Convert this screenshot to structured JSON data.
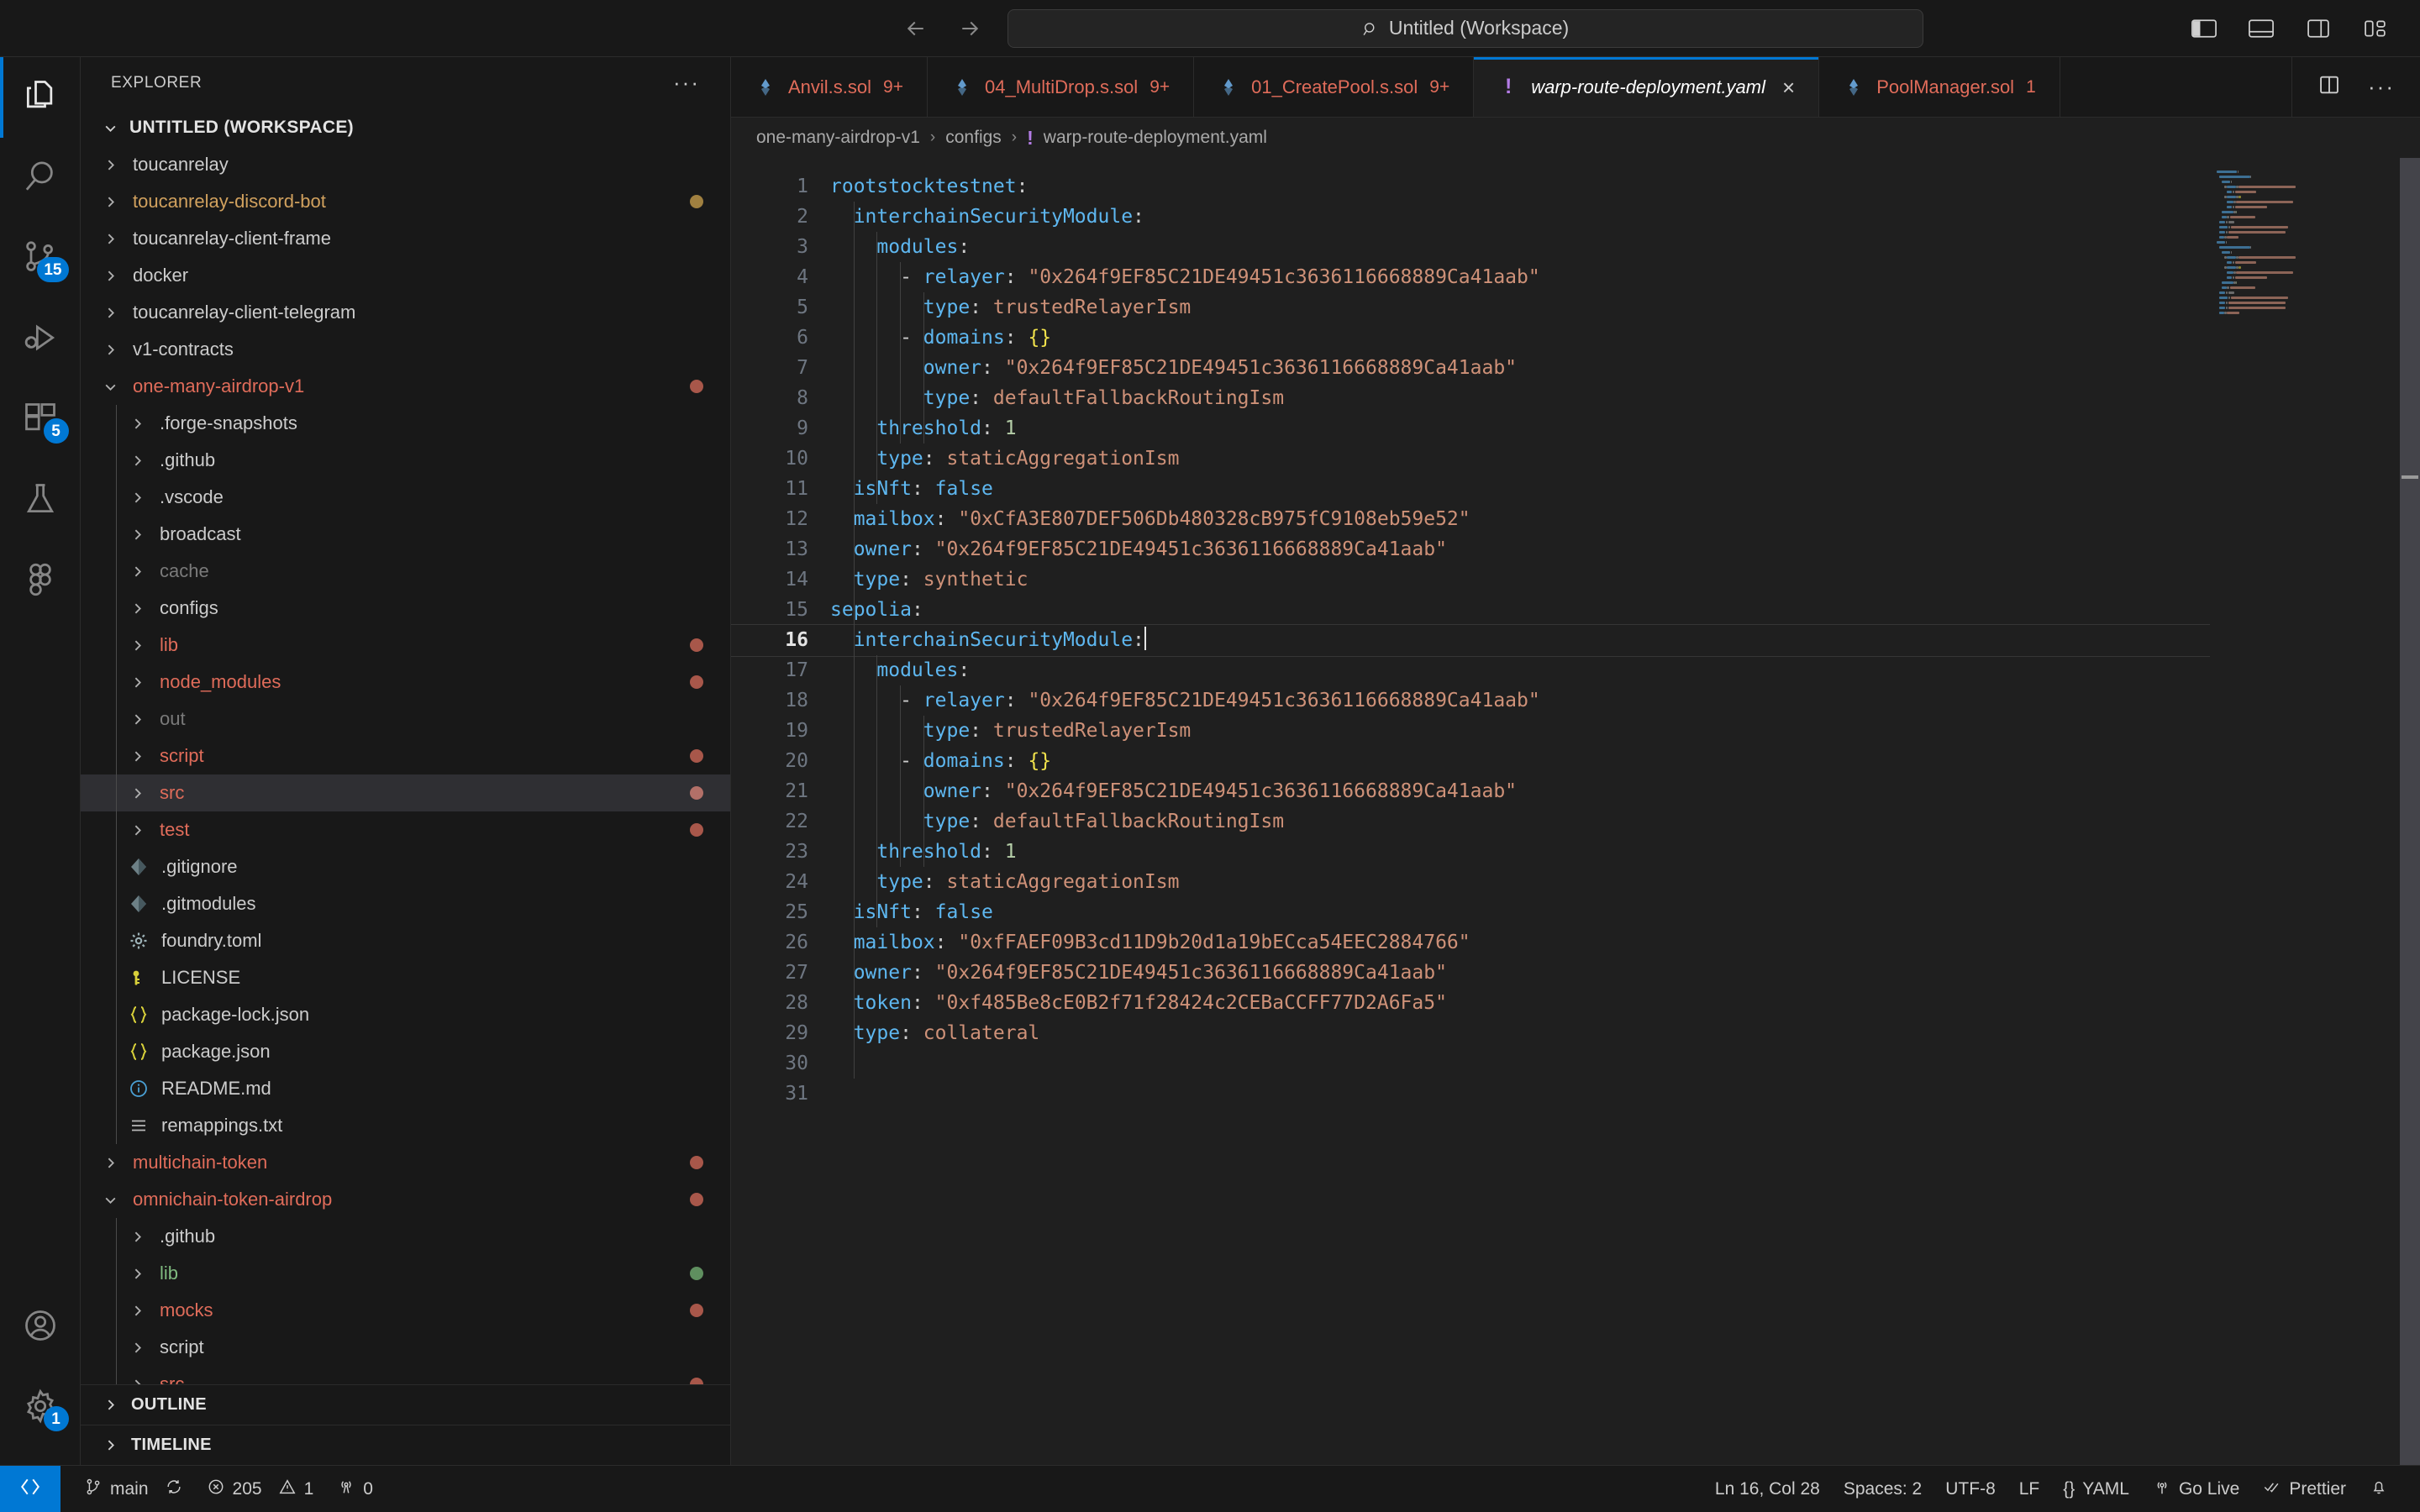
{
  "titlebar": {
    "back_label": "←",
    "forward_label": "→",
    "command_center_text": "Untitled (Workspace)",
    "layout_icons": [
      "toggle-primary-sidebar",
      "toggle-panel",
      "toggle-secondary-sidebar",
      "customize-layout"
    ]
  },
  "activitybar": {
    "items": [
      {
        "name": "explorer",
        "icon": "files-icon",
        "badge": ""
      },
      {
        "name": "search",
        "icon": "search-icon",
        "badge": ""
      },
      {
        "name": "source-control",
        "icon": "source-control-icon",
        "badge": "15"
      },
      {
        "name": "run-and-debug",
        "icon": "run-debug-icon",
        "badge": ""
      },
      {
        "name": "extensions",
        "icon": "extensions-icon",
        "badge": "5"
      },
      {
        "name": "testing",
        "icon": "beaker-icon",
        "badge": ""
      },
      {
        "name": "figma",
        "icon": "figma-icon",
        "badge": ""
      }
    ],
    "bottom": [
      {
        "name": "accounts",
        "icon": "account-icon",
        "badge": ""
      },
      {
        "name": "manage",
        "icon": "gear-icon",
        "badge": "1"
      }
    ]
  },
  "sidebar": {
    "header_title": "EXPLORER",
    "more_actions": "···",
    "root_label": "UNTITLED (WORKSPACE)",
    "tree": [
      {
        "label": "toucanrelay",
        "depth": 1,
        "type": "folder",
        "open": false,
        "color": "#cccccc",
        "dot": ""
      },
      {
        "label": "toucanrelay-discord-bot",
        "depth": 1,
        "type": "folder",
        "open": false,
        "color": "#d1a15e",
        "dot": "#a08040"
      },
      {
        "label": "toucanrelay-client-frame",
        "depth": 1,
        "type": "folder",
        "open": false,
        "color": "#cccccc",
        "dot": ""
      },
      {
        "label": "docker",
        "depth": 1,
        "type": "folder",
        "open": false,
        "color": "#cccccc",
        "dot": ""
      },
      {
        "label": "toucanrelay-client-telegram",
        "depth": 1,
        "type": "folder",
        "open": false,
        "color": "#cccccc",
        "dot": ""
      },
      {
        "label": "v1-contracts",
        "depth": 1,
        "type": "folder",
        "open": false,
        "color": "#cccccc",
        "dot": ""
      },
      {
        "label": "one-many-airdrop-v1",
        "depth": 1,
        "type": "folder",
        "open": true,
        "color": "#e06c5a",
        "dot": "#a8574a"
      },
      {
        "label": ".forge-snapshots",
        "depth": 2,
        "type": "folder",
        "open": false,
        "color": "#cccccc",
        "dot": ""
      },
      {
        "label": ".github",
        "depth": 2,
        "type": "folder",
        "open": false,
        "color": "#cccccc",
        "dot": ""
      },
      {
        "label": ".vscode",
        "depth": 2,
        "type": "folder",
        "open": false,
        "color": "#cccccc",
        "dot": ""
      },
      {
        "label": "broadcast",
        "depth": 2,
        "type": "folder",
        "open": false,
        "color": "#cccccc",
        "dot": ""
      },
      {
        "label": "cache",
        "depth": 2,
        "type": "folder",
        "open": false,
        "color": "#7a7a7a",
        "dot": ""
      },
      {
        "label": "configs",
        "depth": 2,
        "type": "folder",
        "open": false,
        "color": "#cccccc",
        "dot": ""
      },
      {
        "label": "lib",
        "depth": 2,
        "type": "folder",
        "open": false,
        "color": "#e06c5a",
        "dot": "#a8574a"
      },
      {
        "label": "node_modules",
        "depth": 2,
        "type": "folder",
        "open": false,
        "color": "#e06c5a",
        "dot": "#a8574a"
      },
      {
        "label": "out",
        "depth": 2,
        "type": "folder",
        "open": false,
        "color": "#7a7a7a",
        "dot": ""
      },
      {
        "label": "script",
        "depth": 2,
        "type": "folder",
        "open": false,
        "color": "#e06c5a",
        "dot": "#a8574a"
      },
      {
        "label": "src",
        "depth": 2,
        "type": "folder",
        "open": false,
        "color": "#e06c5a",
        "dot": "#b37068",
        "selected": true
      },
      {
        "label": "test",
        "depth": 2,
        "type": "folder",
        "open": false,
        "color": "#e06c5a",
        "dot": "#a8574a"
      },
      {
        "label": ".gitignore",
        "depth": 2,
        "type": "git",
        "open": false,
        "color": "#cccccc",
        "dot": ""
      },
      {
        "label": ".gitmodules",
        "depth": 2,
        "type": "git",
        "open": false,
        "color": "#cccccc",
        "dot": ""
      },
      {
        "label": "foundry.toml",
        "depth": 2,
        "type": "toml",
        "open": false,
        "color": "#cccccc",
        "dot": ""
      },
      {
        "label": "LICENSE",
        "depth": 2,
        "type": "license",
        "open": false,
        "color": "#cccccc",
        "dot": ""
      },
      {
        "label": "package-lock.json",
        "depth": 2,
        "type": "json",
        "open": false,
        "color": "#cccccc",
        "dot": ""
      },
      {
        "label": "package.json",
        "depth": 2,
        "type": "json",
        "open": false,
        "color": "#cccccc",
        "dot": ""
      },
      {
        "label": "README.md",
        "depth": 2,
        "type": "md",
        "open": false,
        "color": "#cccccc",
        "dot": ""
      },
      {
        "label": "remappings.txt",
        "depth": 2,
        "type": "txt",
        "open": false,
        "color": "#cccccc",
        "dot": ""
      },
      {
        "label": "multichain-token",
        "depth": 1,
        "type": "folder",
        "open": false,
        "color": "#e06c5a",
        "dot": "#a8574a"
      },
      {
        "label": "omnichain-token-airdrop",
        "depth": 1,
        "type": "folder",
        "open": true,
        "color": "#e06c5a",
        "dot": "#a8574a"
      },
      {
        "label": ".github",
        "depth": 2,
        "type": "folder",
        "open": false,
        "color": "#cccccc",
        "dot": ""
      },
      {
        "label": "lib",
        "depth": 2,
        "type": "folder",
        "open": false,
        "color": "#7fba7f",
        "dot": "#5f8f5f"
      },
      {
        "label": "mocks",
        "depth": 2,
        "type": "folder",
        "open": false,
        "color": "#e06c5a",
        "dot": "#a8574a"
      },
      {
        "label": "script",
        "depth": 2,
        "type": "folder",
        "open": false,
        "color": "#cccccc",
        "dot": ""
      },
      {
        "label": "src",
        "depth": 2,
        "type": "folder",
        "open": false,
        "color": "#e06c5a",
        "dot": "#a8574a"
      }
    ],
    "sections": [
      {
        "label": "OUTLINE"
      },
      {
        "label": "TIMELINE"
      }
    ]
  },
  "tabs": [
    {
      "name": "Anvil.s.sol",
      "count": "9+",
      "icon": "solidity-icon",
      "active": false,
      "dirty": false
    },
    {
      "name": "04_MultiDrop.s.sol",
      "count": "9+",
      "icon": "solidity-icon",
      "active": false,
      "dirty": false
    },
    {
      "name": "01_CreatePool.s.sol",
      "count": "9+",
      "icon": "solidity-icon",
      "active": false,
      "dirty": false
    },
    {
      "name": "warp-route-deployment.yaml",
      "count": "",
      "icon": "yaml-icon",
      "active": true,
      "dirty": false,
      "close_label": "×"
    },
    {
      "name": "PoolManager.sol",
      "count": "1",
      "icon": "solidity-icon",
      "active": false,
      "dirty": false
    }
  ],
  "tab_actions": [
    "split-editor-icon",
    "more-actions-icon"
  ],
  "breadcrumbs": {
    "items": [
      "one-many-airdrop-v1",
      "configs",
      "warp-route-deployment.yaml"
    ],
    "separator": "›",
    "file_icon": "!"
  },
  "editor": {
    "language": "yaml",
    "cursor_line": 16,
    "lines": [
      {
        "n": 1,
        "indent": 0,
        "tokens": [
          {
            "t": "rootstocktestnet",
            "c": "k"
          },
          {
            "t": ":",
            "c": "p"
          }
        ]
      },
      {
        "n": 2,
        "indent": 2,
        "tokens": [
          {
            "t": "interchainSecurityModule",
            "c": "k"
          },
          {
            "t": ":",
            "c": "p"
          }
        ]
      },
      {
        "n": 3,
        "indent": 4,
        "tokens": [
          {
            "t": "modules",
            "c": "k"
          },
          {
            "t": ":",
            "c": "p"
          }
        ]
      },
      {
        "n": 4,
        "indent": 6,
        "tokens": [
          {
            "t": "- ",
            "c": "d"
          },
          {
            "t": "relayer",
            "c": "k"
          },
          {
            "t": ": ",
            "c": "p"
          },
          {
            "t": "\"0x264f9EF85C21DE49451c3636116668889Ca41aab\"",
            "c": "s"
          }
        ]
      },
      {
        "n": 5,
        "indent": 8,
        "tokens": [
          {
            "t": "type",
            "c": "k"
          },
          {
            "t": ": ",
            "c": "p"
          },
          {
            "t": "trustedRelayerIsm",
            "c": "v"
          }
        ]
      },
      {
        "n": 6,
        "indent": 6,
        "tokens": [
          {
            "t": "- ",
            "c": "d"
          },
          {
            "t": "domains",
            "c": "k"
          },
          {
            "t": ": ",
            "c": "p"
          },
          {
            "t": "{}",
            "c": "br"
          }
        ]
      },
      {
        "n": 7,
        "indent": 8,
        "tokens": [
          {
            "t": "owner",
            "c": "k"
          },
          {
            "t": ": ",
            "c": "p"
          },
          {
            "t": "\"0x264f9EF85C21DE49451c3636116668889Ca41aab\"",
            "c": "s"
          }
        ]
      },
      {
        "n": 8,
        "indent": 8,
        "tokens": [
          {
            "t": "type",
            "c": "k"
          },
          {
            "t": ": ",
            "c": "p"
          },
          {
            "t": "defaultFallbackRoutingIsm",
            "c": "v"
          }
        ]
      },
      {
        "n": 9,
        "indent": 4,
        "tokens": [
          {
            "t": "threshold",
            "c": "k"
          },
          {
            "t": ": ",
            "c": "p"
          },
          {
            "t": "1",
            "c": "n"
          }
        ]
      },
      {
        "n": 10,
        "indent": 4,
        "tokens": [
          {
            "t": "type",
            "c": "k"
          },
          {
            "t": ": ",
            "c": "p"
          },
          {
            "t": "staticAggregationIsm",
            "c": "v"
          }
        ]
      },
      {
        "n": 11,
        "indent": 2,
        "tokens": [
          {
            "t": "isNft",
            "c": "k"
          },
          {
            "t": ": ",
            "c": "p"
          },
          {
            "t": "false",
            "c": "b"
          }
        ]
      },
      {
        "n": 12,
        "indent": 2,
        "tokens": [
          {
            "t": "mailbox",
            "c": "k"
          },
          {
            "t": ": ",
            "c": "p"
          },
          {
            "t": "\"0xCfA3E807DEF506Db480328cB975fC9108eb59e52\"",
            "c": "s"
          }
        ]
      },
      {
        "n": 13,
        "indent": 2,
        "tokens": [
          {
            "t": "owner",
            "c": "k"
          },
          {
            "t": ": ",
            "c": "p"
          },
          {
            "t": "\"0x264f9EF85C21DE49451c3636116668889Ca41aab\"",
            "c": "s"
          }
        ]
      },
      {
        "n": 14,
        "indent": 2,
        "tokens": [
          {
            "t": "type",
            "c": "k"
          },
          {
            "t": ": ",
            "c": "p"
          },
          {
            "t": "synthetic",
            "c": "v"
          }
        ]
      },
      {
        "n": 15,
        "indent": 0,
        "tokens": [
          {
            "t": "sepolia",
            "c": "k"
          },
          {
            "t": ":",
            "c": "p"
          }
        ]
      },
      {
        "n": 16,
        "indent": 2,
        "tokens": [
          {
            "t": "interchainSecurityModule",
            "c": "k"
          },
          {
            "t": ":",
            "c": "p"
          }
        ],
        "cursor": true
      },
      {
        "n": 17,
        "indent": 4,
        "tokens": [
          {
            "t": "modules",
            "c": "k"
          },
          {
            "t": ":",
            "c": "p"
          }
        ]
      },
      {
        "n": 18,
        "indent": 6,
        "tokens": [
          {
            "t": "- ",
            "c": "d"
          },
          {
            "t": "relayer",
            "c": "k"
          },
          {
            "t": ": ",
            "c": "p"
          },
          {
            "t": "\"0x264f9EF85C21DE49451c3636116668889Ca41aab\"",
            "c": "s"
          }
        ]
      },
      {
        "n": 19,
        "indent": 8,
        "tokens": [
          {
            "t": "type",
            "c": "k"
          },
          {
            "t": ": ",
            "c": "p"
          },
          {
            "t": "trustedRelayerIsm",
            "c": "v"
          }
        ]
      },
      {
        "n": 20,
        "indent": 6,
        "tokens": [
          {
            "t": "- ",
            "c": "d"
          },
          {
            "t": "domains",
            "c": "k"
          },
          {
            "t": ": ",
            "c": "p"
          },
          {
            "t": "{}",
            "c": "br"
          }
        ]
      },
      {
        "n": 21,
        "indent": 8,
        "tokens": [
          {
            "t": "owner",
            "c": "k"
          },
          {
            "t": ": ",
            "c": "p"
          },
          {
            "t": "\"0x264f9EF85C21DE49451c3636116668889Ca41aab\"",
            "c": "s"
          }
        ]
      },
      {
        "n": 22,
        "indent": 8,
        "tokens": [
          {
            "t": "type",
            "c": "k"
          },
          {
            "t": ": ",
            "c": "p"
          },
          {
            "t": "defaultFallbackRoutingIsm",
            "c": "v"
          }
        ]
      },
      {
        "n": 23,
        "indent": 4,
        "tokens": [
          {
            "t": "threshold",
            "c": "k"
          },
          {
            "t": ": ",
            "c": "p"
          },
          {
            "t": "1",
            "c": "n"
          }
        ]
      },
      {
        "n": 24,
        "indent": 4,
        "tokens": [
          {
            "t": "type",
            "c": "k"
          },
          {
            "t": ": ",
            "c": "p"
          },
          {
            "t": "staticAggregationIsm",
            "c": "v"
          }
        ]
      },
      {
        "n": 25,
        "indent": 2,
        "tokens": [
          {
            "t": "isNft",
            "c": "k"
          },
          {
            "t": ": ",
            "c": "p"
          },
          {
            "t": "false",
            "c": "b"
          }
        ]
      },
      {
        "n": 26,
        "indent": 2,
        "tokens": [
          {
            "t": "mailbox",
            "c": "k"
          },
          {
            "t": ": ",
            "c": "p"
          },
          {
            "t": "\"0xfFAEF09B3cd11D9b20d1a19bECca54EEC2884766\"",
            "c": "s"
          }
        ]
      },
      {
        "n": 27,
        "indent": 2,
        "tokens": [
          {
            "t": "owner",
            "c": "k"
          },
          {
            "t": ": ",
            "c": "p"
          },
          {
            "t": "\"0x264f9EF85C21DE49451c3636116668889Ca41aab\"",
            "c": "s"
          }
        ]
      },
      {
        "n": 28,
        "indent": 2,
        "tokens": [
          {
            "t": "token",
            "c": "k"
          },
          {
            "t": ": ",
            "c": "p"
          },
          {
            "t": "\"0xf485Be8cE0B2f71f28424c2CEBaCCFF77D2A6Fa5\"",
            "c": "s"
          }
        ]
      },
      {
        "n": 29,
        "indent": 2,
        "tokens": [
          {
            "t": "type",
            "c": "k"
          },
          {
            "t": ": ",
            "c": "p"
          },
          {
            "t": "collateral",
            "c": "v"
          }
        ]
      },
      {
        "n": 30,
        "indent": 0,
        "tokens": []
      },
      {
        "n": 31,
        "indent": 0,
        "tokens": []
      }
    ]
  },
  "statusbar": {
    "remote_icon": "remote-window-icon",
    "left": [
      {
        "icon": "git-branch-icon",
        "label": "main",
        "name": "branch"
      },
      {
        "icon": "sync-icon",
        "label": "",
        "name": "sync-changes"
      },
      {
        "icon": "error-icon",
        "label": "205",
        "name": "errors"
      },
      {
        "icon": "warning-icon",
        "label": "1",
        "name": "warnings"
      },
      {
        "icon": "radio-tower-icon",
        "label": "0",
        "name": "ports"
      }
    ],
    "right": [
      {
        "icon": "",
        "label": "Ln 16, Col 28",
        "name": "cursor-position"
      },
      {
        "icon": "",
        "label": "Spaces: 2",
        "name": "indentation"
      },
      {
        "icon": "",
        "label": "UTF-8",
        "name": "encoding"
      },
      {
        "icon": "",
        "label": "LF",
        "name": "eol"
      },
      {
        "icon": "braces-icon",
        "label": "YAML",
        "name": "language-mode"
      },
      {
        "icon": "broadcast-icon",
        "label": "Go Live",
        "name": "go-live"
      },
      {
        "icon": "checkmarks-icon",
        "label": "Prettier",
        "name": "prettier"
      },
      {
        "icon": "bell-icon",
        "label": "",
        "name": "notifications"
      }
    ]
  },
  "colors": {
    "accent": "#0078d4",
    "bg": "#1f1f1f",
    "chrome": "#181818",
    "text": "#cccccc",
    "key": "#5eb7f0",
    "string": "#ce9178",
    "number": "#b5cea8",
    "brace": "#f2e34c",
    "error_red": "#e06c5a"
  }
}
